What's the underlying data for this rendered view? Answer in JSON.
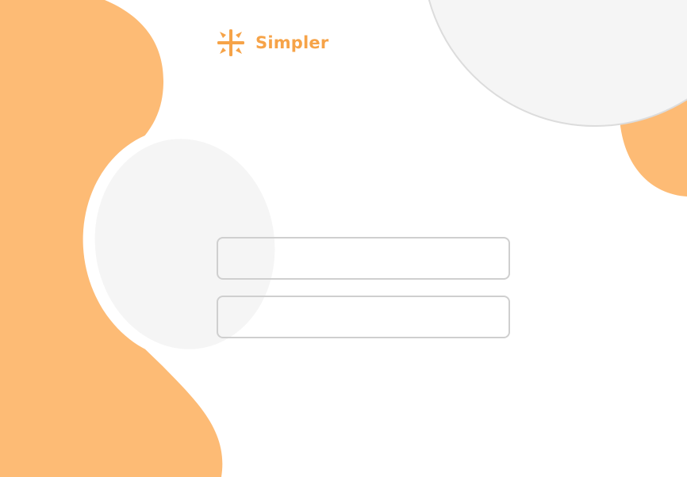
{
  "app": {
    "brand_name": "Simpler"
  },
  "theme": {
    "accent": "#f6a348",
    "blob_orange": "#fdbb75",
    "blob_grey": "#f5f5f5",
    "ring_grey": "#dcdcdc",
    "field_border": "#cfcfcf"
  },
  "icons": {
    "brand_mark": "sun-cross-logo-icon"
  },
  "form": {
    "fields": [
      {
        "value": "",
        "placeholder": ""
      },
      {
        "value": "",
        "placeholder": ""
      }
    ]
  }
}
